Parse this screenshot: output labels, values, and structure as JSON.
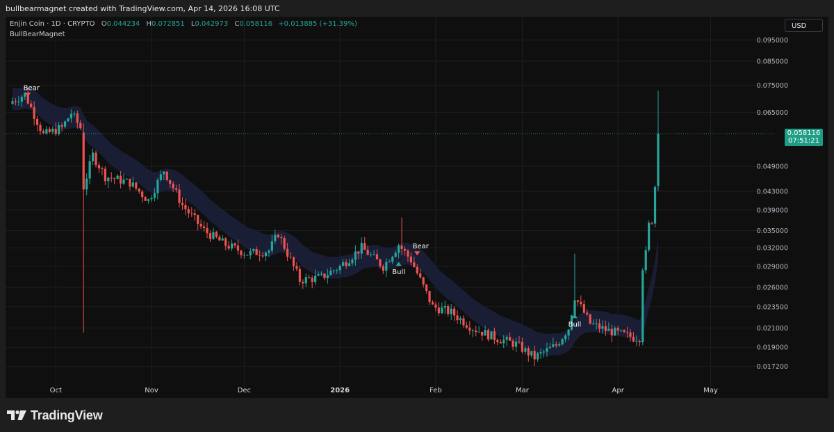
{
  "header": {
    "caption": "bullbearmagnet created with TradingView.com, Apr 14, 2026 16:08 UTC"
  },
  "legend": {
    "symbol": "Enjin Coin · 1D · CRYPTO",
    "open_label": "O",
    "open": "0.044234",
    "high_label": "H",
    "high": "0.072851",
    "low_label": "L",
    "low": "0.042973",
    "close_label": "C",
    "close": "0.058116",
    "change": "+0.013885 (+31.39%)",
    "indicator": "BullBearMagnet"
  },
  "toolbar": {
    "currency": "USD"
  },
  "price_tag": {
    "price": "0.058116",
    "countdown": "07:51:21"
  },
  "brand": {
    "name": "TradingView"
  },
  "colors": {
    "bull": "#26a69a",
    "bear": "#ef5350",
    "band": "#1a2038",
    "grid": "#1f1f1f",
    "text": "#b2b5be",
    "price_line": "#1f9c85"
  },
  "icons": {
    "brand_logo": "tradingview-logo-icon",
    "bear_marker": "down-triangle-icon",
    "bull_marker": "up-triangle-icon"
  },
  "chart_data": {
    "type": "candlestick",
    "y_ticks": [
      "0.095000",
      "0.085000",
      "0.075000",
      "0.065000",
      "0.049000",
      "0.043000",
      "0.039000",
      "0.035000",
      "0.032000",
      "0.029000",
      "0.026000",
      "0.023500",
      "0.021000",
      "0.019000",
      "0.017200"
    ],
    "y_scale": "log",
    "ylim": [
      0.0159,
      0.105
    ],
    "x_ticks": [
      {
        "label": "Oct",
        "date": "2025-10-01"
      },
      {
        "label": "Nov",
        "date": "2025-11-01"
      },
      {
        "label": "Dec",
        "date": "2025-12-01"
      },
      {
        "label": "2026",
        "date": "2026-01-01"
      },
      {
        "label": "Feb",
        "date": "2026-02-01"
      },
      {
        "label": "Mar",
        "date": "2026-03-01"
      },
      {
        "label": "Apr",
        "date": "2026-04-01"
      },
      {
        "label": "May",
        "date": "2026-05-01"
      }
    ],
    "x_range": [
      "2025-09-17",
      "2026-05-20"
    ],
    "anchor_closes": [
      [
        "2025-09-17",
        0.069
      ],
      [
        "2025-09-21",
        0.0715
      ],
      [
        "2025-09-27",
        0.0578
      ],
      [
        "2025-10-03",
        0.06
      ],
      [
        "2025-10-06",
        0.0648
      ],
      [
        "2025-10-09",
        0.06
      ],
      [
        "2025-10-10",
        0.044
      ],
      [
        "2025-10-13",
        0.052
      ],
      [
        "2025-10-17",
        0.0465
      ],
      [
        "2025-10-25",
        0.045
      ],
      [
        "2025-10-31",
        0.041
      ],
      [
        "2025-11-05",
        0.048
      ],
      [
        "2025-11-11",
        0.04
      ],
      [
        "2025-11-18",
        0.035
      ],
      [
        "2025-11-25",
        0.0325
      ],
      [
        "2025-12-02",
        0.031
      ],
      [
        "2025-12-09",
        0.0315
      ],
      [
        "2025-12-12",
        0.0345
      ],
      [
        "2025-12-19",
        0.027
      ],
      [
        "2025-12-26",
        0.0274
      ],
      [
        "2026-01-01",
        0.029
      ],
      [
        "2026-01-08",
        0.032
      ],
      [
        "2026-01-15",
        0.029
      ],
      [
        "2026-01-20",
        0.0325
      ],
      [
        "2026-01-24",
        0.03
      ],
      [
        "2026-01-31",
        0.0235
      ],
      [
        "2026-02-06",
        0.0228
      ],
      [
        "2026-02-13",
        0.021
      ],
      [
        "2026-02-20",
        0.02
      ],
      [
        "2026-02-27",
        0.0193
      ],
      [
        "2026-03-05",
        0.018
      ],
      [
        "2026-03-12",
        0.0192
      ],
      [
        "2026-03-16",
        0.021
      ],
      [
        "2026-03-18",
        0.0248
      ],
      [
        "2026-03-23",
        0.0215
      ],
      [
        "2026-03-28",
        0.0208
      ],
      [
        "2026-04-06",
        0.02
      ],
      [
        "2026-04-08",
        0.02
      ],
      [
        "2026-04-09",
        0.029
      ],
      [
        "2026-04-10",
        0.031
      ],
      [
        "2026-04-11",
        0.036
      ],
      [
        "2026-04-12",
        0.037
      ],
      [
        "2026-04-13",
        0.0442
      ],
      [
        "2026-04-14",
        0.058116
      ]
    ],
    "annotations": [
      {
        "label": "Bear",
        "type": "bear",
        "date": "2025-09-22",
        "price": 0.07
      },
      {
        "label": "Bull",
        "type": "bull",
        "date": "2026-01-20",
        "price": 0.0292
      },
      {
        "label": "Bear",
        "type": "bear",
        "date": "2026-01-26",
        "price": 0.0305
      },
      {
        "label": "Bull",
        "type": "bull",
        "date": "2026-03-18",
        "price": 0.0222
      }
    ],
    "last_price": 0.058116
  }
}
